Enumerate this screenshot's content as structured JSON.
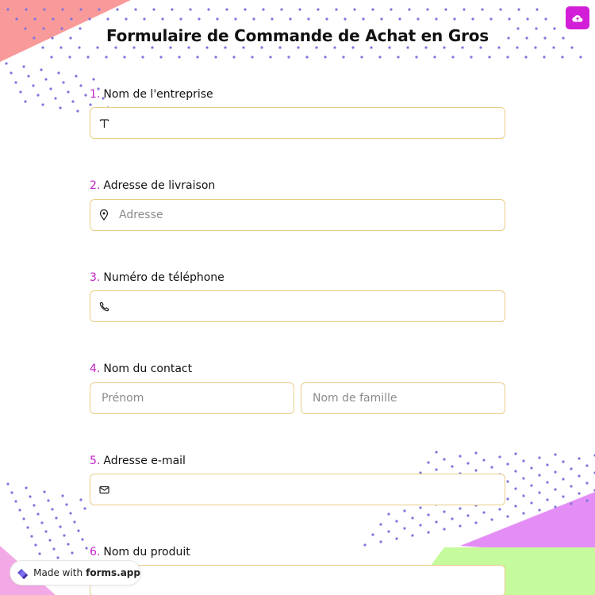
{
  "form": {
    "title": "Formulaire de Commande de Achat en Gros"
  },
  "questions": [
    {
      "number": "1.",
      "label": "Nom de l'entreprise",
      "icon": "text-type-icon",
      "placeholder": ""
    },
    {
      "number": "2.",
      "label": "Adresse de livraison",
      "icon": "map-pin-icon",
      "placeholder": "Adresse"
    },
    {
      "number": "3.",
      "label": "Numéro de téléphone",
      "icon": "phone-icon",
      "placeholder": ""
    },
    {
      "number": "4.",
      "label": "Nom du contact",
      "first_placeholder": "Prénom",
      "last_placeholder": "Nom de famille"
    },
    {
      "number": "5.",
      "label": "Adresse e-mail",
      "icon": "mail-icon",
      "placeholder": ""
    },
    {
      "number": "6.",
      "label": "Nom du produit",
      "placeholder": ""
    }
  ],
  "footer": {
    "made_with": "Made with",
    "brand": "forms.app"
  },
  "colors": {
    "accent": "#c322c9",
    "button": "#d21ed6",
    "field_border": "#e8cd86",
    "coral": "#f99a9a",
    "lavender": "#e48ef5",
    "lime": "#c5fb9c",
    "dots": "#7f74de"
  },
  "icons": {
    "save": "cloud-upload-icon",
    "logo": "forms-app-logo-icon"
  }
}
